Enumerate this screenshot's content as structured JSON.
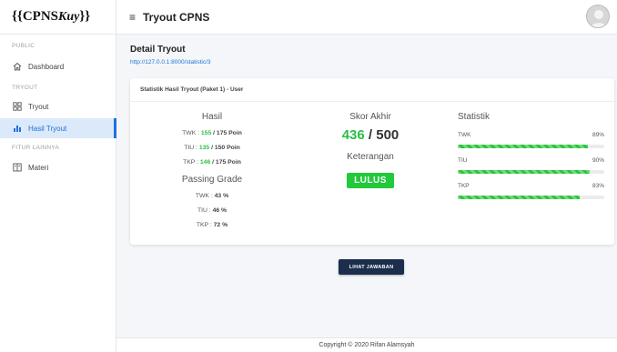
{
  "brand": {
    "prefix": "{{CPNS ",
    "script": "Kuy",
    "suffix": "}}"
  },
  "sidebar": {
    "sections": [
      "PUBLIC",
      "TRYOUT",
      "FITUR LAINNYA"
    ],
    "items": [
      {
        "label": "Dashboard",
        "icon": "home-icon"
      },
      {
        "label": "Tryout",
        "icon": "grid-icon"
      },
      {
        "label": "Hasil Tryout",
        "icon": "chart-icon",
        "active": true
      },
      {
        "label": "Materi",
        "icon": "book-icon"
      }
    ]
  },
  "header": {
    "menu_icon": "≡",
    "title": "Tryout CPNS"
  },
  "page": {
    "title": "Detail Tryout",
    "url": "http://127.0.0.1:8000/statistic/3"
  },
  "card": {
    "title": "Statistik Hasil Tryout (Paket 1) - User",
    "hasil": {
      "heading": "Hasil",
      "rows": [
        {
          "label": "TWK",
          "score": "155",
          "max": "/ 175 Poin"
        },
        {
          "label": "TIU",
          "score": "135",
          "max": "/ 150 Poin"
        },
        {
          "label": "TKP",
          "score": "146",
          "max": "/ 175 Poin"
        }
      ]
    },
    "passing": {
      "heading": "Passing Grade",
      "rows": [
        {
          "label": "TWK",
          "value": "43 %"
        },
        {
          "label": "TIU",
          "value": "46 %"
        },
        {
          "label": "TKP",
          "value": "72 %"
        }
      ]
    },
    "skor": {
      "heading": "Skor Akhir",
      "value": "436",
      "max": "/ 500"
    },
    "keterangan": {
      "heading": "Keterangan",
      "status": "LULUS"
    },
    "statistik": {
      "heading": "Statistik",
      "rows": [
        {
          "label": "TWK",
          "percent_text": "89%",
          "percent": 89
        },
        {
          "label": "TIU",
          "percent_text": "90%",
          "percent": 90
        },
        {
          "label": "TKP",
          "percent_text": "83%",
          "percent": 83
        }
      ]
    }
  },
  "button": {
    "label": "LIHAT JAWABAN"
  },
  "footer": {
    "text": "Copyright © 2020 Rifan Alamsyah"
  },
  "colors": {
    "accent": "#1e73d8",
    "success": "#22c93a",
    "button": "#1b2e4b"
  }
}
